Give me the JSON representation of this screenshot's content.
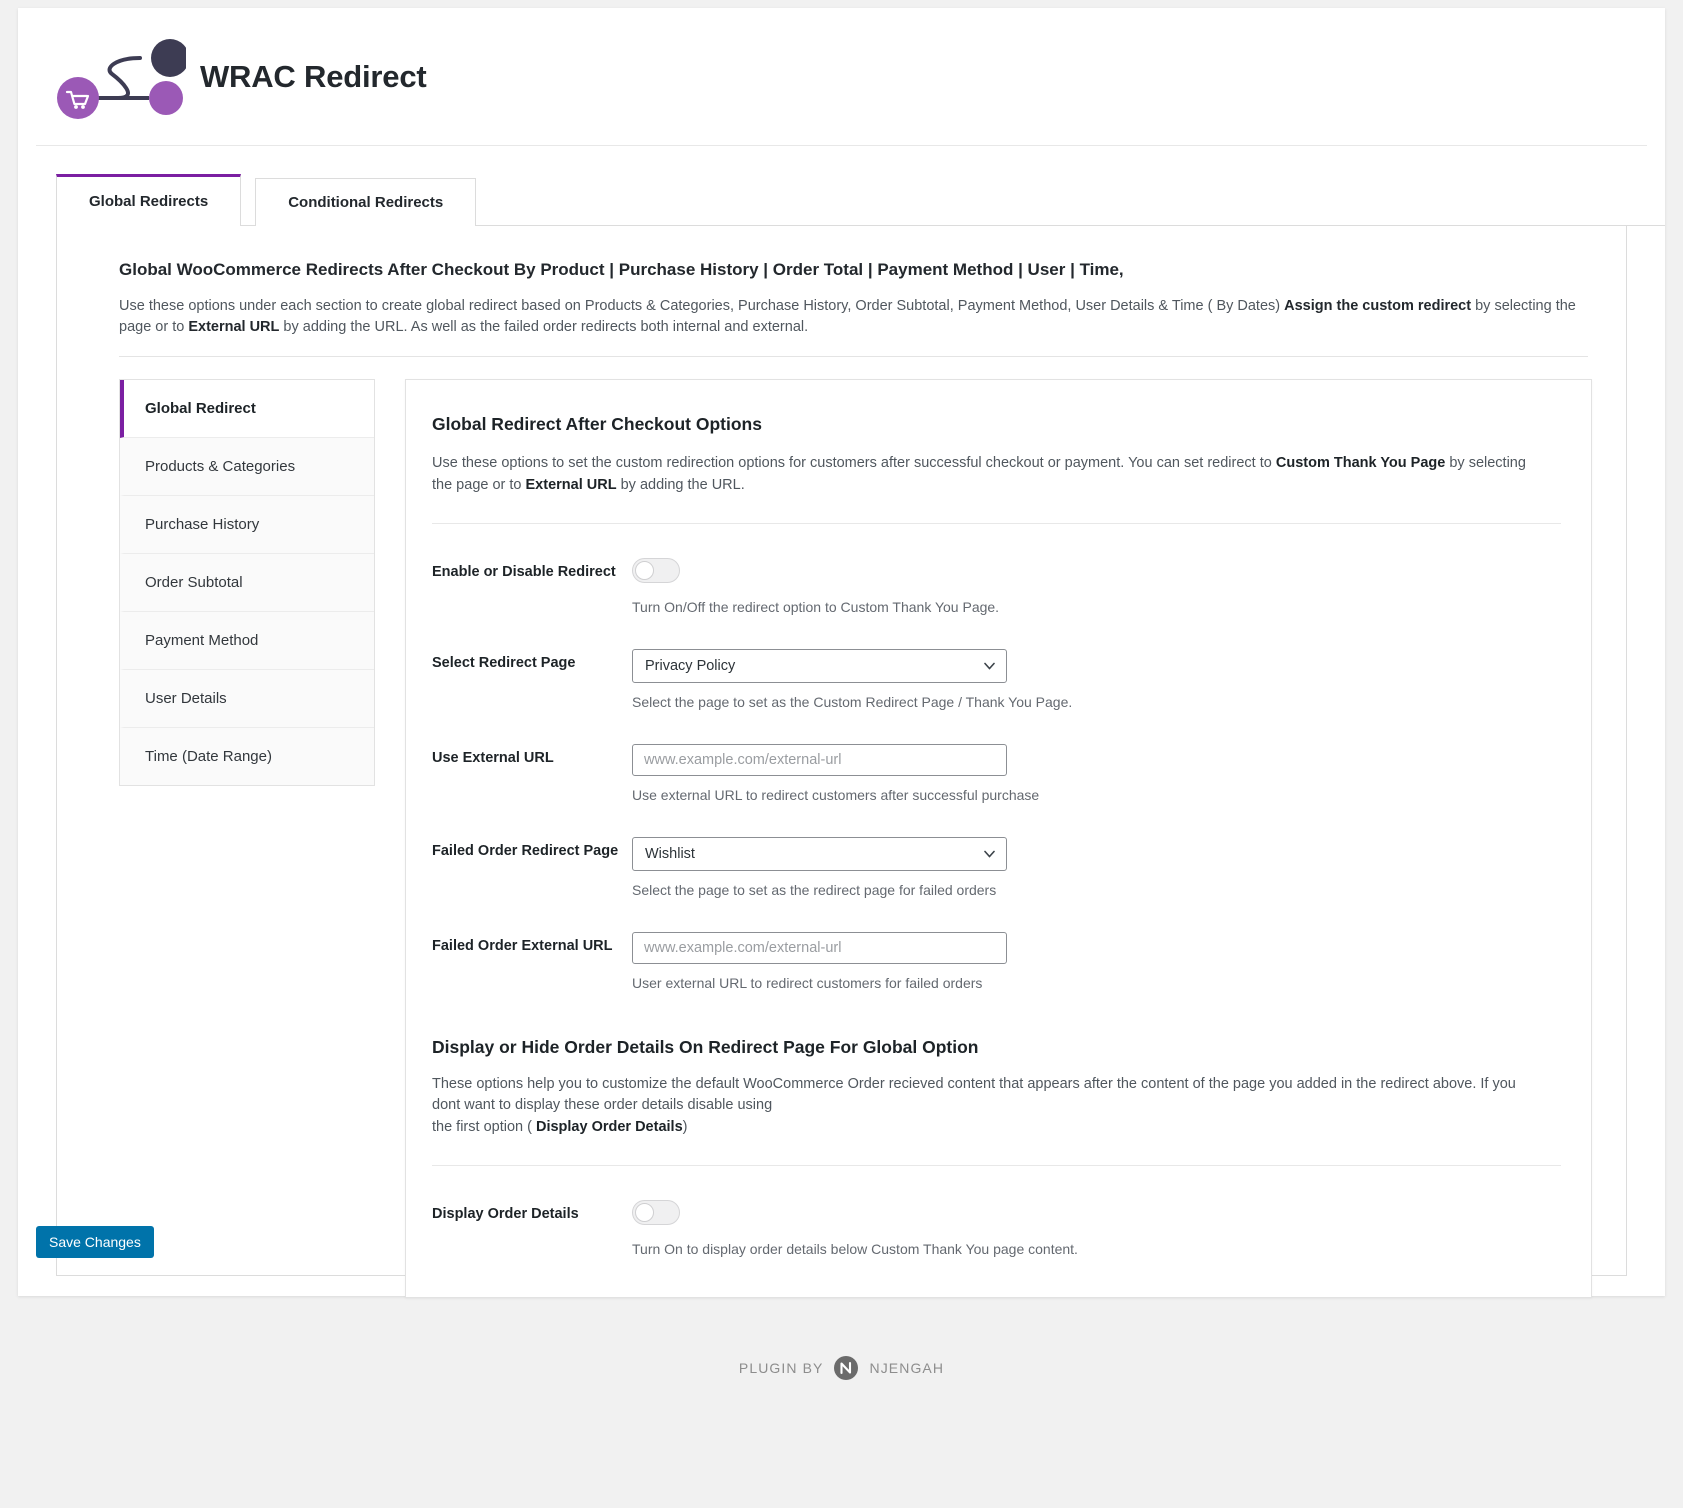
{
  "header": {
    "title": "WRAC Redirect",
    "logo_icon": "wrac-redirect-logo"
  },
  "tabs": [
    {
      "label": "Global Redirects",
      "active": true
    },
    {
      "label": "Conditional Redirects",
      "active": false
    }
  ],
  "intro": {
    "title": "Global WooCommerce Redirects After Checkout By Product | Purchase History | Order Total | Payment Method | User | Time,",
    "desc_part1": "Use these options under each section to create global redirect based on Products & Categories, Purchase History, Order Subtotal, Payment Method, User Details & Time ( By Dates) ",
    "desc_bold1": "Assign the custom redirect",
    "desc_part2": " by selecting the page or to ",
    "desc_bold2": "External URL",
    "desc_part3": " by adding the URL. As well as the failed order redirects both internal and external."
  },
  "sidebar": {
    "items": [
      {
        "label": "Global Redirect",
        "active": true
      },
      {
        "label": "Products & Categories",
        "active": false
      },
      {
        "label": "Purchase History",
        "active": false
      },
      {
        "label": "Order Subtotal",
        "active": false
      },
      {
        "label": "Payment Method",
        "active": false
      },
      {
        "label": "User Details",
        "active": false
      },
      {
        "label": "Time (Date Range)",
        "active": false
      }
    ]
  },
  "section": {
    "title": "Global Redirect After Checkout Options",
    "desc_part1": "Use these options to set the custom redirection options for customers after successful checkout or payment. You can set redirect to ",
    "desc_bold1": "Custom Thank You Page",
    "desc_part2": " by selecting the page or to ",
    "desc_bold2": "External URL",
    "desc_part3": " by adding the URL."
  },
  "fields": {
    "enable_redirect": {
      "label": "Enable or Disable Redirect",
      "state": "off",
      "help": "Turn On/Off the redirect option to Custom Thank You Page."
    },
    "select_redirect_page": {
      "label": "Select Redirect Page",
      "value": "Privacy Policy",
      "help": "Select the page to set as the Custom Redirect Page / Thank You Page."
    },
    "use_external_url": {
      "label": "Use External URL",
      "value": "",
      "placeholder": "www.example.com/external-url",
      "help": "Use external URL to redirect customers after successful purchase"
    },
    "failed_order_redirect_page": {
      "label": "Failed Order Redirect Page",
      "value": "Wishlist",
      "help": "Select the page to set as the redirect page for failed orders"
    },
    "failed_order_external_url": {
      "label": "Failed Order External URL",
      "value": "",
      "placeholder": "www.example.com/external-url",
      "help": "User external URL to redirect customers for failed orders"
    },
    "display_order_details": {
      "label": "Display Order Details",
      "state": "off",
      "help": "Turn On to display order details below Custom Thank You page content."
    }
  },
  "order_details_section": {
    "title": "Display or Hide Order Details On Redirect Page For Global Option",
    "desc_line1": "These options help you to customize the default WooCommerce Order recieved content that appears after the content of the page you added in the redirect above. If you dont want to display these order details disable using",
    "desc_line2_prefix": "the first option ( ",
    "desc_line2_bold": "Display Order Details",
    "desc_line2_suffix": ")"
  },
  "actions": {
    "save_label": "Save Changes"
  },
  "footer": {
    "prefix": "PLUGIN BY",
    "brand": "NJENGAH",
    "mark_icon": "njengah-mark-icon"
  },
  "colors": {
    "accent_purple": "#7b1fa2",
    "logo_dark": "#3d3c53",
    "logo_purple": "#9b59b6",
    "save_blue": "#0073aa"
  }
}
